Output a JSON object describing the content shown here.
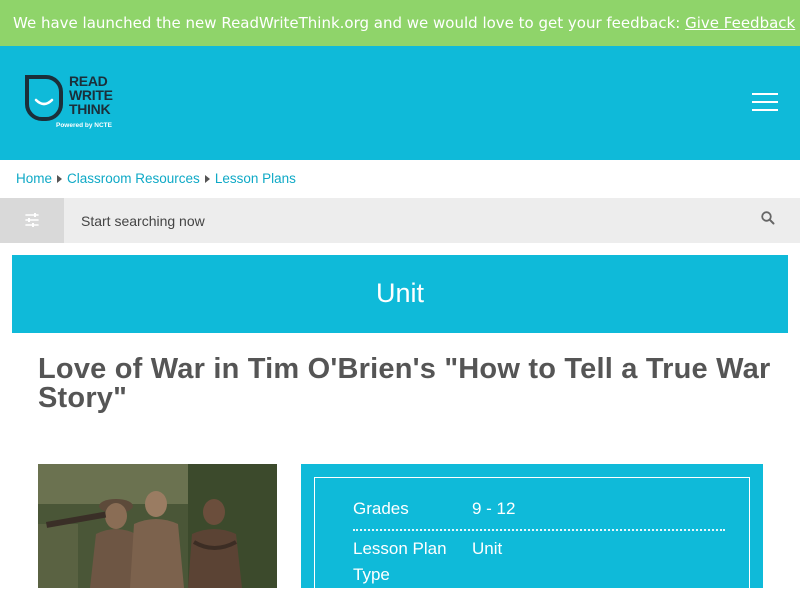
{
  "banner": {
    "text": "We have launched the new ReadWriteThink.org and we would love to get your feedback: ",
    "link_label": "Give Feedback"
  },
  "header": {
    "logo": {
      "line1": "READ",
      "line2": "WRITE",
      "line3": "THINK",
      "powered_by": "Powered by NCTE"
    },
    "menu_icon": "hamburger-icon"
  },
  "breadcrumb": {
    "items": [
      "Home",
      "Classroom Resources",
      "Lesson Plans"
    ]
  },
  "search": {
    "placeholder": "Start searching now",
    "filter_icon": "sliders-icon",
    "search_icon": "magnifier-icon"
  },
  "unit_banner": {
    "label": "Unit"
  },
  "page": {
    "title": "Love of War in Tim O'Brien's \"How to Tell a True War Story\""
  },
  "details": {
    "rows": [
      {
        "label": "Grades",
        "value": "9 - 12"
      },
      {
        "label": "Lesson Plan Type",
        "value": "Unit"
      }
    ]
  },
  "colors": {
    "banner_green": "#8fd46a",
    "brand_cyan": "#0fbad9",
    "link_cyan": "#0fa9c6",
    "title_gray": "#555555"
  }
}
